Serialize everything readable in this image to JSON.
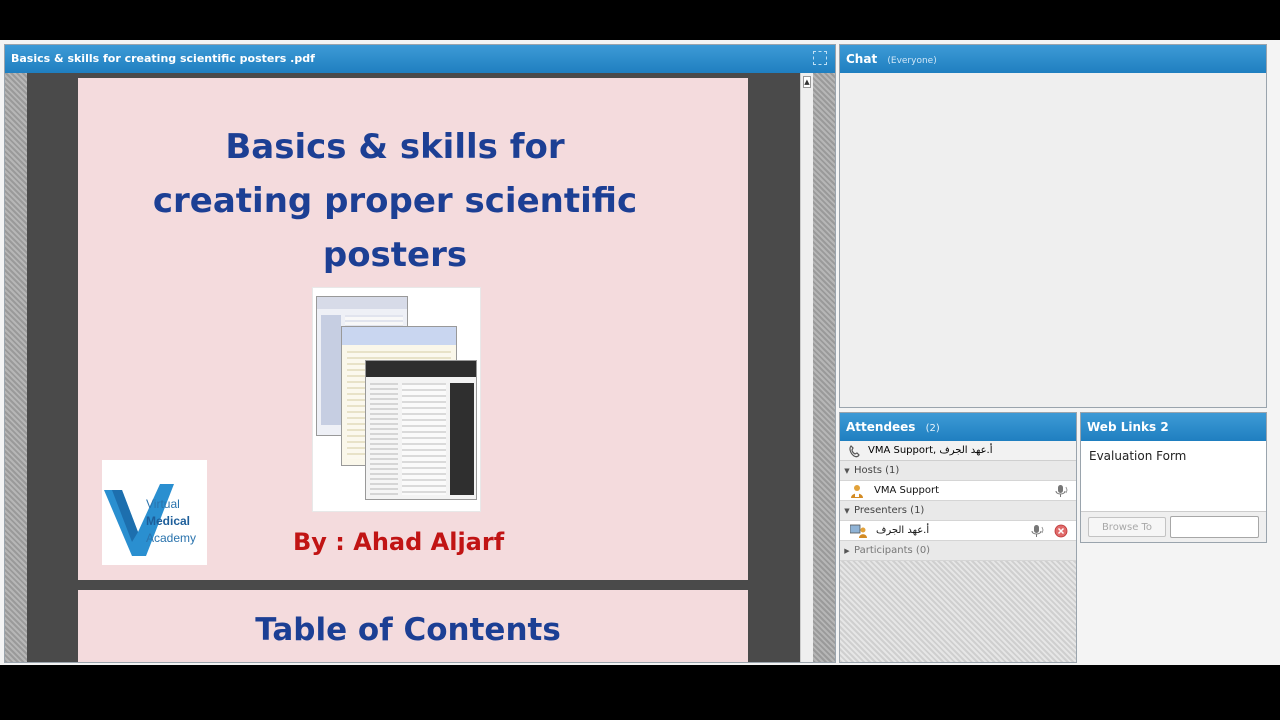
{
  "share_pod": {
    "title": "Basics & skills for creating scientific posters .pdf",
    "slide1": {
      "title_lines": [
        "Basics & skills for",
        "creating proper scientific",
        "posters"
      ],
      "byline": "By : Ahad Aljarf",
      "logo": {
        "line1": "Virtual",
        "line2": "Medical",
        "line3": "Academy"
      }
    },
    "slide2": {
      "title": "Table of Contents"
    }
  },
  "chat": {
    "title": "Chat",
    "audience": "(Everyone)"
  },
  "attendees": {
    "title": "Attendees",
    "count": "(2)",
    "top_row": "VMA Support, أ.عهد الجرف",
    "groups": [
      {
        "label": "Hosts (1)",
        "members": [
          "VMA Support"
        ]
      },
      {
        "label": "Presenters (1)",
        "members": [
          "أ.عهد الجرف"
        ]
      },
      {
        "label": "Participants (0)",
        "members": []
      }
    ]
  },
  "web_links": {
    "title": "Web Links 2",
    "items": [
      "Evaluation Form"
    ],
    "browse_label": "Browse To"
  },
  "colors": {
    "header_blue": "#1f7fc0",
    "slide_bg": "#f4dbdd",
    "title_blue": "#1c3f94",
    "byline_red": "#c11414"
  }
}
